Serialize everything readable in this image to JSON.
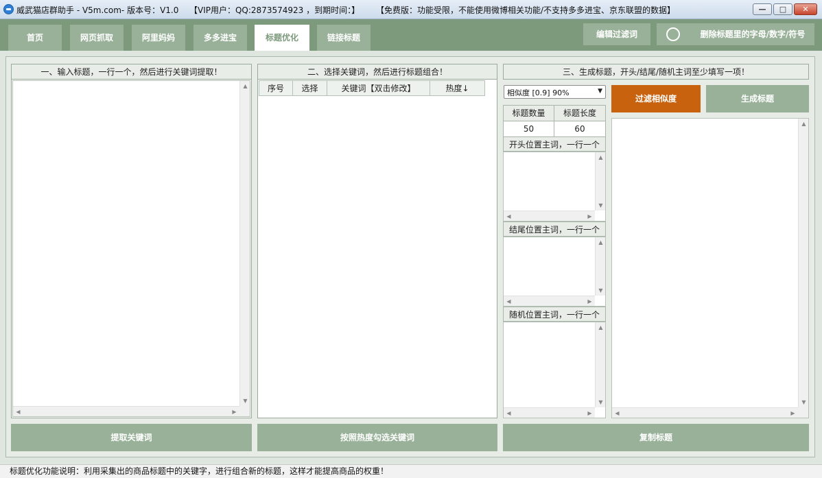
{
  "window": {
    "app_title": "威武猫店群助手 - V5m.com- 版本号：V1.0",
    "vip_info": "【VIP用户：QQ:2873574923 ，到期时间：】",
    "free_notice": "【免费版：功能受限，不能使用微博相关功能/不支持多多进宝、京东联盟的数据】",
    "minimize_glyph": "—",
    "maximize_glyph": "□",
    "close_glyph": "✕"
  },
  "tabs": [
    {
      "label": "首页"
    },
    {
      "label": "网页抓取"
    },
    {
      "label": "阿里妈妈"
    },
    {
      "label": "多多进宝"
    },
    {
      "label": "标题优化",
      "active": true
    },
    {
      "label": "链接标题"
    }
  ],
  "toolbar": {
    "edit_filter_label": "编辑过滤词",
    "remove_chars_label": "删除标题里的字母/数字/符号"
  },
  "panel1": {
    "header": "一、输入标题，一行一个，然后进行关键词提取！",
    "button": "提取关键词"
  },
  "panel2": {
    "header": "二、选择关键词，然后进行标题组合！",
    "columns": [
      "序号",
      "选择",
      "关键词【双击修改】",
      "热度↓"
    ],
    "button": "按照热度勾选关键词"
  },
  "panel3": {
    "header": "三、生成标题，开头/结尾/随机主词至少填写一项！",
    "similarity_select": "相似度 [0.9] 90%",
    "filter_button": "过滤相似度",
    "generate_button": "生成标题",
    "count_label": "标题数量",
    "length_label": "标题长度",
    "count_value": "50",
    "length_value": "60",
    "start_words_label": "开头位置主词，一行一个",
    "end_words_label": "结尾位置主词，一行一个",
    "random_words_label": "随机位置主词，一行一个",
    "copy_button": "复制标题"
  },
  "status": {
    "text": "标题优化功能说明：利用采集出的商品标题中的关键字，进行组合新的标题，这样才能提高商品的权重！"
  },
  "colors": {
    "tabbar": "#7d9a7d",
    "button_green": "#98b198",
    "button_orange": "#c8620f"
  }
}
